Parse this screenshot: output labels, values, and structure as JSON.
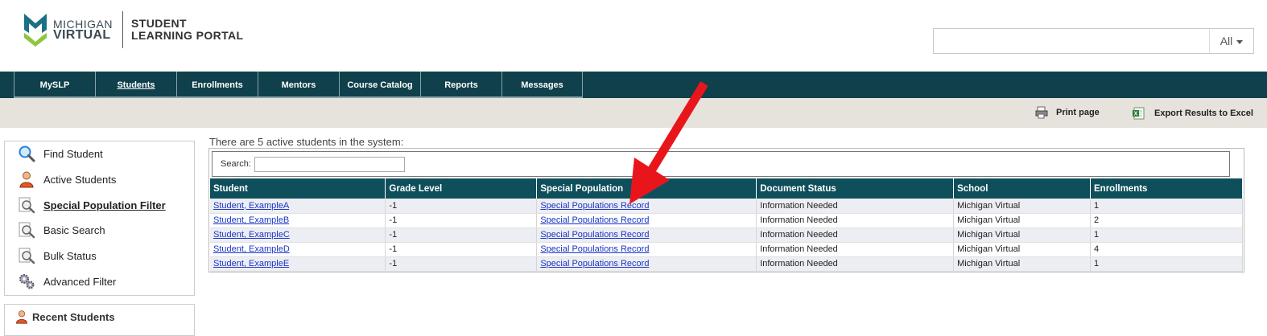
{
  "brand": {
    "logo_line1": "MICHIGAN",
    "logo_line2": "VIRTUAL",
    "portal_line1": "STUDENT",
    "portal_line2": "LEARNING PORTAL",
    "colors": {
      "logo_teal": "#1b6f86",
      "logo_green": "#8dc63f",
      "nav": "#0f404b",
      "table_header": "#0f4f5c",
      "link": "#1a35c9",
      "annotation_arrow": "#e8161b"
    }
  },
  "header_search": {
    "value": "",
    "scope": "All"
  },
  "nav": {
    "tabs": [
      {
        "label": "MySLP",
        "active": false
      },
      {
        "label": "Students",
        "active": true
      },
      {
        "label": "Enrollments",
        "active": false
      },
      {
        "label": "Mentors",
        "active": false
      },
      {
        "label": "Course Catalog",
        "active": false
      },
      {
        "label": "Reports",
        "active": false
      },
      {
        "label": "Messages",
        "active": false
      }
    ]
  },
  "toolbar": {
    "print_label": "Print page",
    "export_label": "Export Results to Excel",
    "print_icon": "printer-icon",
    "export_icon": "excel-export-icon"
  },
  "sidebar": {
    "items": [
      {
        "label": "Find Student",
        "icon": "magnifier-icon",
        "selected": false
      },
      {
        "label": "Active Students",
        "icon": "person-icon",
        "selected": false
      },
      {
        "label": "Special Population Filter",
        "icon": "search-document-icon",
        "selected": true
      },
      {
        "label": "Basic Search",
        "icon": "search-document-icon",
        "selected": false
      },
      {
        "label": "Bulk Status",
        "icon": "search-document-icon",
        "selected": false
      },
      {
        "label": "Advanced Filter",
        "icon": "gears-icon",
        "selected": false
      }
    ],
    "recent_title": "Recent Students"
  },
  "main": {
    "summary": "There are 5 active students in the system:",
    "search_label": "Search:",
    "search_value": "",
    "columns": [
      "Student",
      "Grade Level",
      "Special Population",
      "Document Status",
      "School",
      "Enrollments"
    ],
    "rows": [
      {
        "student": "Student, ExampleA",
        "grade": "-1",
        "special": "Special Populations Record",
        "doc_status": "Information Needed",
        "school": "Michigan Virtual",
        "enrollments": "1"
      },
      {
        "student": "Student, ExampleB",
        "grade": "-1",
        "special": "Special Populations Record",
        "doc_status": "Information Needed",
        "school": "Michigan Virtual",
        "enrollments": "2"
      },
      {
        "student": "Student, ExampleC",
        "grade": "-1",
        "special": "Special Populations Record",
        "doc_status": "Information Needed",
        "school": "Michigan Virtual",
        "enrollments": "1"
      },
      {
        "student": "Student, ExampleD",
        "grade": "-1",
        "special": "Special Populations Record",
        "doc_status": "Information Needed",
        "school": "Michigan Virtual",
        "enrollments": "4"
      },
      {
        "student": "Student, ExampleE",
        "grade": "-1",
        "special": "Special Populations Record",
        "doc_status": "Information Needed",
        "school": "Michigan Virtual",
        "enrollments": "1"
      }
    ]
  }
}
